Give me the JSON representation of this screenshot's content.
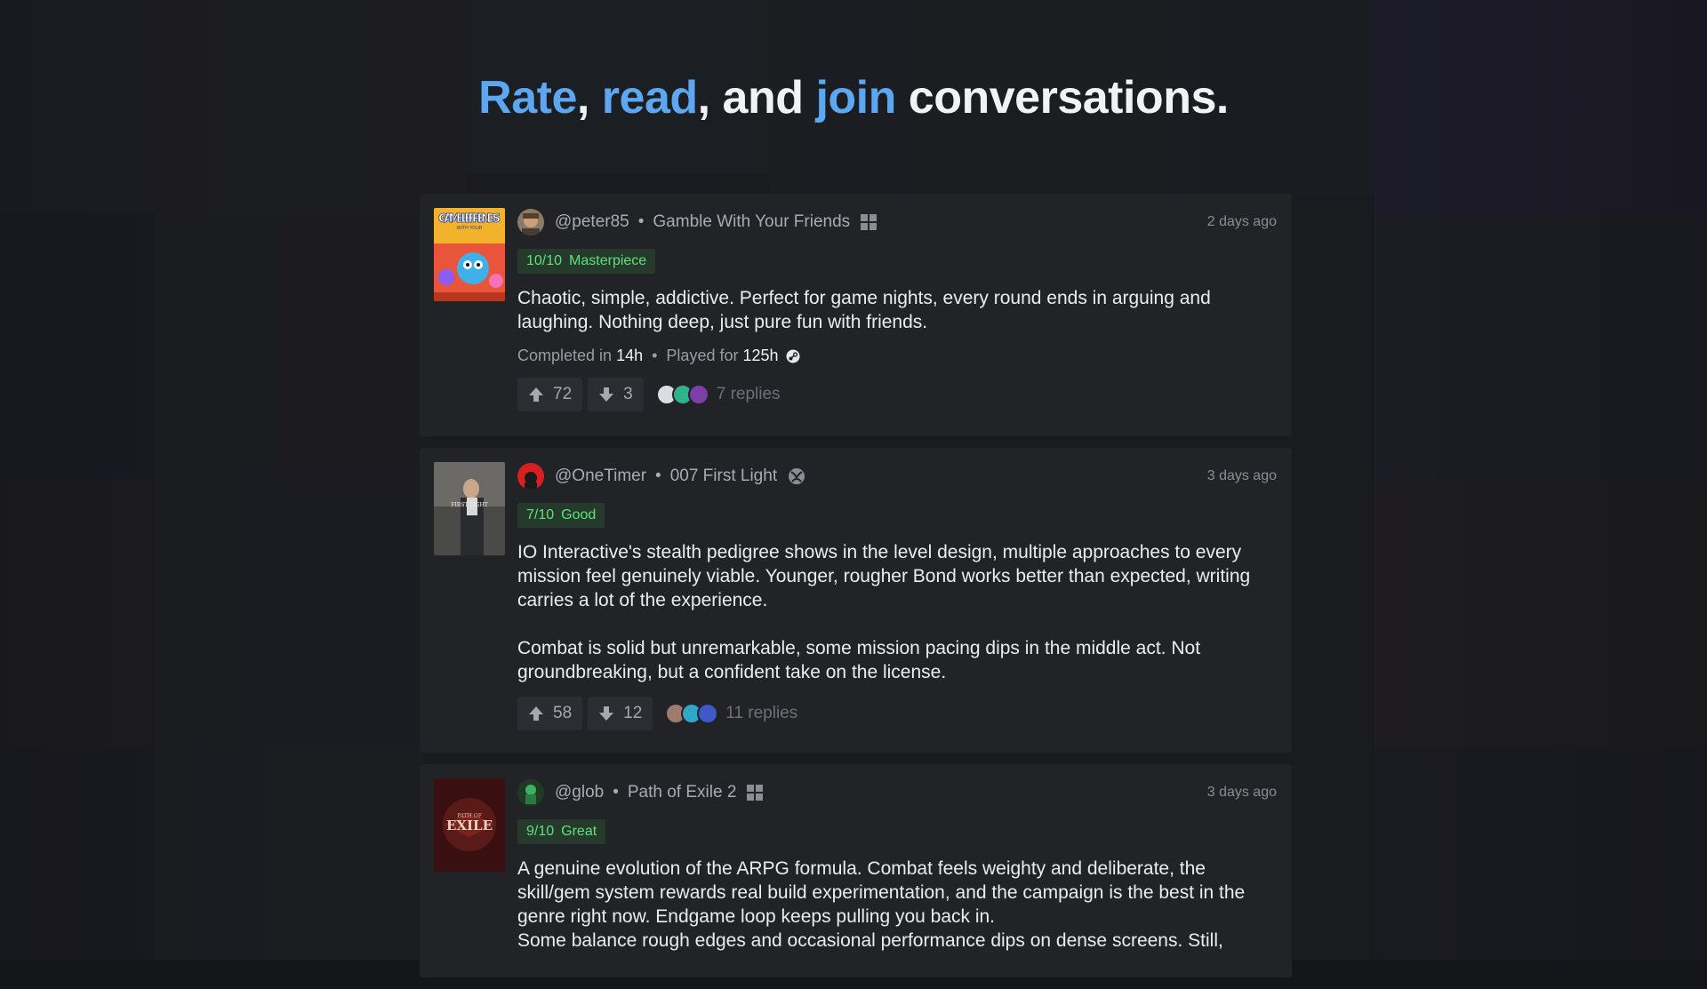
{
  "headline": {
    "word1": "Rate",
    "sep1": ", ",
    "word2": "read",
    "sep2": ", and ",
    "word3": "join",
    "rest": " conversations."
  },
  "reviews": [
    {
      "username": "@peter85",
      "game": "Gamble With Your Friends",
      "platform_icon": "windows-icon",
      "time": "2 days ago",
      "score": "10/10",
      "verdict": "Masterpiece",
      "paragraphs": [
        "Chaotic, simple, addictive. Perfect for game nights, every round ends in arguing and laughing. Nothing deep, just pure fun with friends."
      ],
      "completed_label": "Completed in",
      "completed_value": "14h",
      "played_label": "Played for",
      "played_value": "125h",
      "upvotes": "72",
      "downvotes": "3",
      "replies": "7 replies",
      "accent": "#5fe07d"
    },
    {
      "username": "@OneTimer",
      "game": "007 First Light",
      "platform_icon": "xbox-icon",
      "time": "3 days ago",
      "score": "7/10",
      "verdict": "Good",
      "paragraphs": [
        "IO Interactive's stealth pedigree shows in the level design, multiple approaches to every mission feel genuinely viable. Younger, rougher Bond works better than expected, writing carries a lot of the experience.",
        "Combat is solid but unremarkable, some mission pacing dips in the middle act. Not groundbreaking, but a confident take on the license."
      ],
      "upvotes": "58",
      "downvotes": "12",
      "replies": "11 replies"
    },
    {
      "username": "@glob",
      "game": "Path of Exile 2",
      "platform_icon": "windows-icon",
      "time": "3 days ago",
      "score": "9/10",
      "verdict": "Great",
      "paragraphs": [
        "A genuine evolution of the ARPG formula. Combat feels weighty and deliberate, the skill/gem system rewards real build experimentation, and the campaign is the best in the genre right now. Endgame loop keeps pulling you back in.",
        "Some balance rough edges and occasional performance dips on dense screens. Still,"
      ]
    }
  ],
  "cover_text": {
    "gwyf": "GAMBLE FRIENDS",
    "gwyf_small": "WITH YOUR",
    "firstlight": "FIRST LIGHT",
    "poe": "EXILE",
    "poe_small": "PATH OF"
  },
  "colors": {
    "accent_blue": "#5da7f0",
    "score_green": "#5fe07d",
    "card_bg": "#222327"
  }
}
